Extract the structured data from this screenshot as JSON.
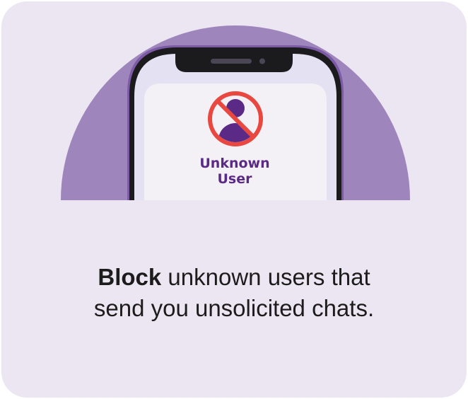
{
  "colors": {
    "card_background": "#ece6f2",
    "semicircle": "#9e86bc",
    "phone_frame": "#1b1a1d",
    "phone_bezel_accent": "#7c5aa6",
    "screen_outer": "#e4e1f2",
    "screen_inner": "#f3f1f6",
    "user_icon": "#5b2a86",
    "block_symbol": "#e8483f",
    "label_text": "#5b2a86",
    "message_text": "#1c1c1c"
  },
  "icons": {
    "blocked_user": "blocked-user-icon"
  },
  "phone": {
    "contact_line1": "Unknown",
    "contact_line2": "User"
  },
  "message": {
    "bold": "Block",
    "rest_line1": " unknown users that",
    "line2": "send you unsolicited chats."
  }
}
